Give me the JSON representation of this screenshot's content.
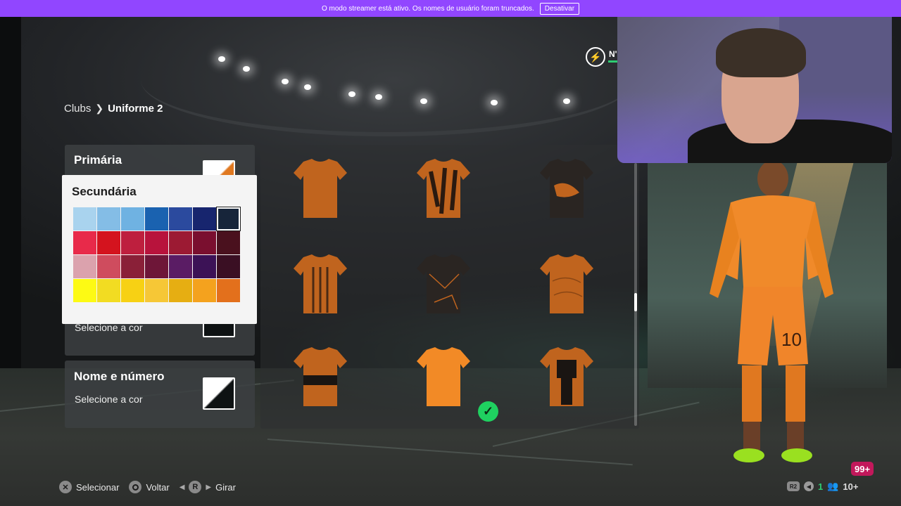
{
  "banner": {
    "message": "O modo streamer está ativo. Os nomes de usuário foram truncados.",
    "button_label": "Desativar",
    "color": "#9146ff"
  },
  "breadcrumb": {
    "parent": "Clubs",
    "separator_icon": "chevron-right-icon",
    "current": "Uniforme 2"
  },
  "panels": {
    "primary": {
      "title": "Primária",
      "swatch_color": "#e07820"
    },
    "hidden_panel": {
      "subtitle": "Selecione a cor",
      "swatch_color": "#0e1213"
    },
    "name_number": {
      "title": "Nome e número",
      "subtitle": "Selecione a cor",
      "swatch_color": "#0e1213"
    }
  },
  "picker": {
    "title": "Secundária",
    "selected_index": 6,
    "colors": [
      "#a9d3ee",
      "#84bde6",
      "#6fb2e2",
      "#1a62b0",
      "#2b4a9e",
      "#17256e",
      "#17253a",
      "#e82a4a",
      "#d4131e",
      "#be1f3e",
      "#b8133c",
      "#9c1a33",
      "#7a0f2f",
      "#4a111e",
      "#dba2ad",
      "#cf4c5e",
      "#8a2038",
      "#6e1638",
      "#5a1c64",
      "#3c1256",
      "#3a0f23",
      "#fdfa14",
      "#f2dc22",
      "#f7d114",
      "#f6c736",
      "#e6ae12",
      "#f4a21e",
      "#e3701c"
    ]
  },
  "kits": [
    {
      "name": "kit-1",
      "pattern": "plain"
    },
    {
      "name": "kit-2",
      "pattern": "tiger"
    },
    {
      "name": "kit-3",
      "pattern": "dark-splatter"
    },
    {
      "name": "kit-4",
      "pattern": "stripes"
    },
    {
      "name": "kit-5",
      "pattern": "dark-cracked"
    },
    {
      "name": "kit-6",
      "pattern": "contour"
    },
    {
      "name": "kit-7",
      "pattern": "band"
    },
    {
      "name": "kit-8",
      "pattern": "bright-selected"
    },
    {
      "name": "kit-9",
      "pattern": "h-block"
    }
  ],
  "selected_kit": 7,
  "level": {
    "label": "N'",
    "icon": "lightning-icon"
  },
  "footer": {
    "select": {
      "glyph": "✕",
      "label": "Selecionar"
    },
    "back": {
      "glyph": "circle",
      "label": "Voltar"
    },
    "rotate": {
      "glyph": "R",
      "label": "Girar"
    }
  },
  "status": {
    "notification_count": "99+",
    "r2_label": "R2",
    "party_count": "1",
    "friends_count": "10+"
  }
}
